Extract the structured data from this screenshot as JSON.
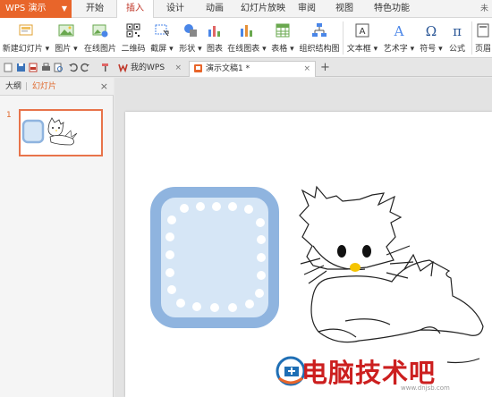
{
  "app": {
    "name": "WPS 演示",
    "brand_color": "#e8652a"
  },
  "menu": {
    "tabs": [
      {
        "label": "开始"
      },
      {
        "label": "插入"
      },
      {
        "label": "设计"
      },
      {
        "label": "动画"
      },
      {
        "label": "幻灯片放映"
      },
      {
        "label": "审阅"
      },
      {
        "label": "视图"
      },
      {
        "label": "特色功能"
      }
    ],
    "active_tab": "插入",
    "right_label": "未"
  },
  "ribbon": {
    "buttons": [
      {
        "label": "新建幻灯片 ▾",
        "icon": "new-slide-icon"
      },
      {
        "label": "图片 ▾",
        "icon": "picture-icon"
      },
      {
        "label": "在线图片",
        "icon": "online-picture-icon"
      },
      {
        "label": "二维码",
        "icon": "qr-code-icon"
      },
      {
        "label": "截屏 ▾",
        "icon": "screenshot-icon"
      },
      {
        "label": "形状 ▾",
        "icon": "shapes-icon"
      },
      {
        "label": "图表",
        "icon": "chart-icon"
      },
      {
        "label": "在线图表 ▾",
        "icon": "online-chart-icon"
      },
      {
        "label": "表格 ▾",
        "icon": "table-icon"
      },
      {
        "label": "组织结构图",
        "icon": "org-chart-icon"
      },
      {
        "label": "文本框 ▾",
        "icon": "textbox-icon"
      },
      {
        "label": "艺术字 ▾",
        "icon": "wordart-icon"
      },
      {
        "label": "符号 ▾",
        "icon": "symbol-icon"
      },
      {
        "label": "公式",
        "icon": "formula-icon"
      },
      {
        "label": "页眉",
        "icon": "header-icon"
      }
    ]
  },
  "quick_access": [
    "new-icon",
    "save-icon",
    "pdf-icon",
    "print-icon",
    "print-preview-icon",
    "undo-icon",
    "redo-icon",
    "format-painter-icon"
  ],
  "doc_tabs": [
    {
      "label": "我的WPS",
      "active": false
    },
    {
      "label": "演示文稿1 *",
      "active": true
    }
  ],
  "left_panel": {
    "tabs": [
      "大纲",
      "幻灯片"
    ],
    "active_tab": "幻灯片",
    "close": "×",
    "slides": [
      {
        "number": "1"
      }
    ]
  },
  "watermark": {
    "text": "电脑技术吧",
    "url": "www.dnjsb.com"
  },
  "colors": {
    "accent": "#e06a2e",
    "frame_blue": "#8fb4df",
    "frame_fill": "#d6e6f6",
    "nose": "#f5c400"
  }
}
